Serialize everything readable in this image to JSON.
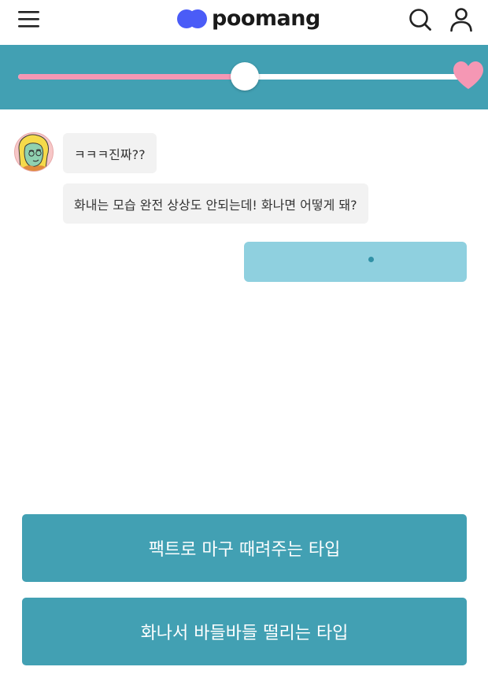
{
  "header": {
    "logo_text": "poomang",
    "menu_icon": "hamburger-menu-icon",
    "search_icon": "search-icon",
    "user_icon": "user-icon",
    "logo_color": "#4a5cf7"
  },
  "progress": {
    "value": 0.5,
    "fill_color": "#f597b4",
    "band_color": "#42a0b3",
    "end_icon": "heart-icon"
  },
  "chat": {
    "messages": [
      {
        "sender": "bot",
        "text": "ㅋㅋㅋ진짜??"
      },
      {
        "sender": "bot",
        "text": "화내는 모습 완전 상상도 안되는데! 화나면 어떻게 돼?"
      }
    ],
    "typing_indicator": true
  },
  "choices": [
    {
      "label": "팩트로 마구 때려주는 타입"
    },
    {
      "label": "화나서 바들바들 떨리는 타입"
    }
  ]
}
